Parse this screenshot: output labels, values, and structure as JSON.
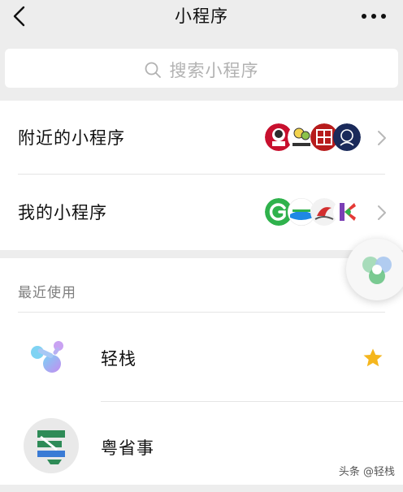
{
  "nav": {
    "title": "小程序",
    "back_icon": "chevron-left-icon",
    "more_icon": "more-dots-icon"
  },
  "search": {
    "placeholder": "搜索小程序",
    "icon": "search-icon"
  },
  "list": {
    "items": [
      {
        "label": "附近的小程序",
        "logos": [
          "kfc-logo",
          "cartoon-logo",
          "red-seal-logo",
          "navy-logo"
        ]
      },
      {
        "label": "我的小程序",
        "logos": [
          "green-g-logo",
          "blue-wave-logo",
          "bird-logo",
          "k-arrow-logo"
        ]
      }
    ]
  },
  "recent": {
    "title": "最近使用",
    "apps": [
      {
        "name": "轻栈",
        "icon": "qingzhan-icon",
        "starred": true
      },
      {
        "name": "粤省事",
        "icon": "yueshengshi-icon",
        "starred": false
      }
    ]
  },
  "colors": {
    "background": "#ededed",
    "card": "#ffffff",
    "star": "#f5b61d",
    "placeholder": "#b2b2b2"
  },
  "watermark": "头条 @轻栈"
}
